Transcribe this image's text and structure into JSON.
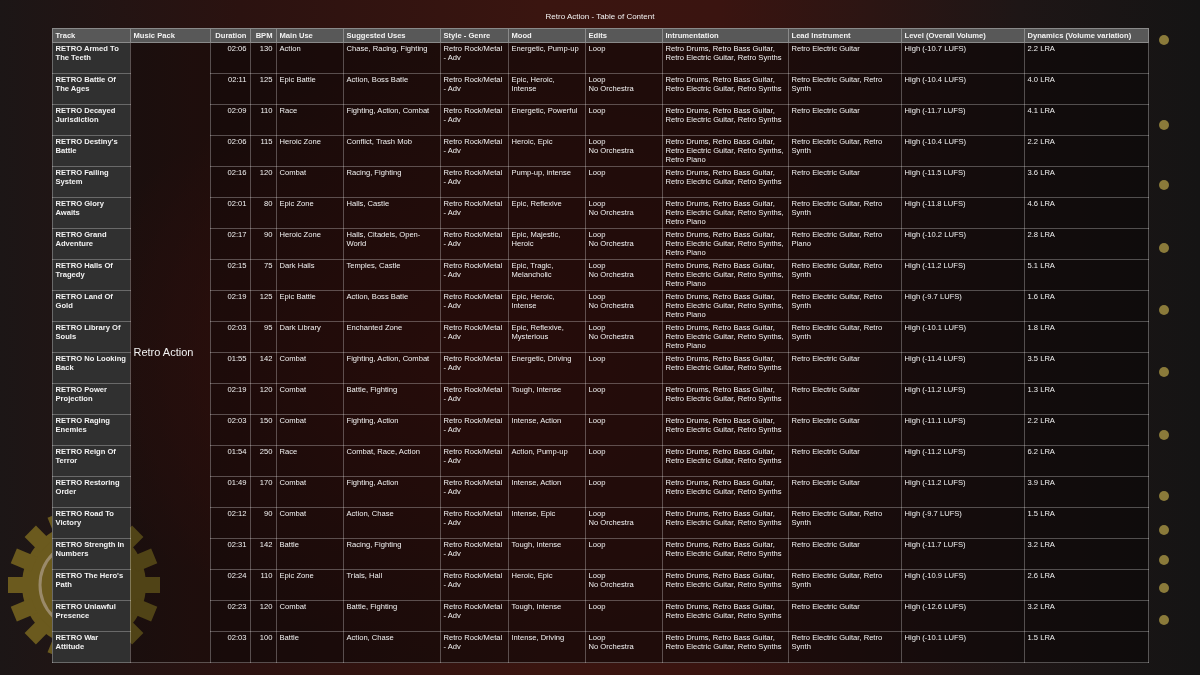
{
  "title": "Retro Action - Table of Content",
  "columns": [
    "Track",
    "Music Pack",
    "Duration",
    "BPM",
    "Main Use",
    "Suggested Uses",
    "Style - Genre",
    "Mood",
    "Edits",
    "Intrumentation",
    "Lead Instrument",
    "Level (Overall Volume)",
    "Dynamics (Volume variation)"
  ],
  "music_pack": "Retro Action",
  "rows": [
    {
      "track": "RETRO Armed To The Teeth",
      "duration": "02:06",
      "bpm": "130",
      "main_use": "Action",
      "suggested_uses": "Chase, Racing, Fighting",
      "style_genre": "Retro Rock/Metal - Adv",
      "mood": "Energetic, Pump-up",
      "edits": [
        "Loop"
      ],
      "instrumentation": "Retro Drums, Retro Bass Guitar, Retro Electric Guitar, Retro Synths",
      "lead_instrument": "Retro Electric Guitar",
      "level": "High (-10.7 LUFS)",
      "dynamics": "2.2 LRA"
    },
    {
      "track": "RETRO Battle Of The Ages",
      "duration": "02:11",
      "bpm": "125",
      "main_use": "Epic Battle",
      "suggested_uses": "Action, Boss Batle",
      "style_genre": "Retro Rock/Metal - Adv",
      "mood": "Epic, Heroic, Intense",
      "edits": [
        "Loop",
        "No Orchestra"
      ],
      "instrumentation": "Retro Drums, Retro Bass Guitar, Retro Electric Guitar, Retro Synths",
      "lead_instrument": "Retro Electric Guitar, Retro Synth",
      "level": "High (-10.4 LUFS)",
      "dynamics": "4.0 LRA"
    },
    {
      "track": "RETRO Decayed Jurisdiction",
      "duration": "02:09",
      "bpm": "110",
      "main_use": "Race",
      "suggested_uses": "Fighting, Action, Combat",
      "style_genre": "Retro Rock/Metal - Adv",
      "mood": "Energetic, Powerful",
      "edits": [
        "Loop"
      ],
      "instrumentation": "Retro Drums, Retro Bass Guitar, Retro Electric Guitar, Retro Synths",
      "lead_instrument": "Retro Electric Guitar",
      "level": "High (-11.7 LUFS)",
      "dynamics": "4.1 LRA"
    },
    {
      "track": "RETRO Destiny's Battle",
      "duration": "02:06",
      "bpm": "115",
      "main_use": "Heroic Zone",
      "suggested_uses": "Conflict, Trash Mob",
      "style_genre": "Retro Rock/Metal - Adv",
      "mood": "Heroic, Epic",
      "edits": [
        "Loop",
        "No Orchestra"
      ],
      "instrumentation": "Retro Drums, Retro Bass Guitar, Retro Electric Guitar, Retro Synths, Retro Piano",
      "lead_instrument": "Retro Electric Guitar, Retro Synth",
      "level": "High (-10.4 LUFS)",
      "dynamics": "2.2 LRA"
    },
    {
      "track": "RETRO Failing System",
      "duration": "02:16",
      "bpm": "120",
      "main_use": "Combat",
      "suggested_uses": "Racing, Fighting",
      "style_genre": "Retro Rock/Metal - Adv",
      "mood": "Pump-up, intense",
      "edits": [
        "Loop"
      ],
      "instrumentation": "Retro Drums, Retro Bass Guitar, Retro Electric Guitar, Retro Synths",
      "lead_instrument": "Retro Electric Guitar",
      "level": "High (-11.5 LUFS)",
      "dynamics": "3.6 LRA"
    },
    {
      "track": "RETRO Glory Awaits",
      "duration": "02:01",
      "bpm": "80",
      "main_use": "Epic Zone",
      "suggested_uses": "Halls, Castle",
      "style_genre": "Retro Rock/Metal - Adv",
      "mood": "Epic, Reflexive",
      "edits": [
        "Loop",
        "No Orchestra"
      ],
      "instrumentation": "Retro Drums, Retro Bass Guitar, Retro Electric Guitar, Retro Synths, Retro Piano",
      "lead_instrument": "Retro Electric Guitar, Retro Synth",
      "level": "High (-11.8 LUFS)",
      "dynamics": "4.6 LRA"
    },
    {
      "track": "RETRO Grand Adventure",
      "duration": "02:17",
      "bpm": "90",
      "main_use": "Heroic Zone",
      "suggested_uses": "Halls, Citadels, Open-World",
      "style_genre": "Retro Rock/Metal - Adv",
      "mood": "Epic, Majestic, Heroic",
      "edits": [
        "Loop",
        "No Orchestra"
      ],
      "instrumentation": "Retro Drums, Retro Bass Guitar, Retro Electric Guitar, Retro Synths, Retro Piano",
      "lead_instrument": "Retro Electric Guitar, Retro Piano",
      "level": "High (-10.2 LUFS)",
      "dynamics": "2.8 LRA"
    },
    {
      "track": "RETRO Halls Of Tragedy",
      "duration": "02:15",
      "bpm": "75",
      "main_use": "Dark Halls",
      "suggested_uses": "Temples, Castle",
      "style_genre": "Retro Rock/Metal - Adv",
      "mood": "Epic, Tragic, Melancholic",
      "edits": [
        "Loop",
        "No Orchestra"
      ],
      "instrumentation": "Retro Drums, Retro Bass Guitar, Retro Electric Guitar, Retro Synths, Retro Piano",
      "lead_instrument": "Retro Electric Guitar, Retro Synth",
      "level": "High (-11.2 LUFS)",
      "dynamics": "5.1 LRA"
    },
    {
      "track": "RETRO Land Of Gold",
      "duration": "02:19",
      "bpm": "125",
      "main_use": "Epic Battle",
      "suggested_uses": "Action, Boss Batle",
      "style_genre": "Retro Rock/Metal - Adv",
      "mood": "Epic, Heroic, Intense",
      "edits": [
        "Loop",
        "No Orchestra"
      ],
      "instrumentation": "Retro Drums, Retro Bass Guitar, Retro Electric Guitar, Retro Synths, Retro Piano",
      "lead_instrument": "Retro Electric Guitar, Retro Synth",
      "level": "High (-9.7 LUFS)",
      "dynamics": "1.6 LRA"
    },
    {
      "track": "RETRO Library Of Souls",
      "duration": "02:03",
      "bpm": "95",
      "main_use": "Dark Library",
      "suggested_uses": "Enchanted Zone",
      "style_genre": "Retro Rock/Metal - Adv",
      "mood": "Epic, Reflexive, Mysterious",
      "edits": [
        "Loop",
        "No Orchestra"
      ],
      "instrumentation": "Retro Drums, Retro Bass Guitar, Retro Electric Guitar, Retro Synths, Retro Piano",
      "lead_instrument": "Retro Electric Guitar, Retro Synth",
      "level": "High (-10.1 LUFS)",
      "dynamics": "1.8 LRA"
    },
    {
      "track": "RETRO No Looking Back",
      "duration": "01:55",
      "bpm": "142",
      "main_use": "Combat",
      "suggested_uses": "Fighting, Action, Combat",
      "style_genre": "Retro Rock/Metal - Adv",
      "mood": "Energetic, Driving",
      "edits": [
        "Loop"
      ],
      "instrumentation": "Retro Drums, Retro Bass Guitar, Retro Electric Guitar, Retro Synths",
      "lead_instrument": "Retro Electric Guitar",
      "level": "High (-11.4 LUFS)",
      "dynamics": "3.5 LRA"
    },
    {
      "track": "RETRO Power Projection",
      "duration": "02:19",
      "bpm": "120",
      "main_use": "Combat",
      "suggested_uses": "Battle, Fighting",
      "style_genre": "Retro Rock/Metal - Adv",
      "mood": "Tough, Intense",
      "edits": [
        "Loop"
      ],
      "instrumentation": "Retro Drums, Retro Bass Guitar, Retro Electric Guitar, Retro Synths",
      "lead_instrument": "Retro Electric Guitar",
      "level": "High (-11.2 LUFS)",
      "dynamics": "1.3 LRA"
    },
    {
      "track": "RETRO Raging Enemies",
      "duration": "02:03",
      "bpm": "150",
      "main_use": "Combat",
      "suggested_uses": "Fighting, Action",
      "style_genre": "Retro Rock/Metal - Adv",
      "mood": "Intense, Action",
      "edits": [
        "Loop"
      ],
      "instrumentation": "Retro Drums, Retro Bass Guitar, Retro Electric Guitar, Retro Synths",
      "lead_instrument": "Retro Electric Guitar",
      "level": "High (-11.1 LUFS)",
      "dynamics": "2.2 LRA"
    },
    {
      "track": "RETRO Reign Of Terror",
      "duration": "01:54",
      "bpm": "250",
      "main_use": "Race",
      "suggested_uses": "Combat, Race, Action",
      "style_genre": "Retro Rock/Metal - Adv",
      "mood": "Action, Pump-up",
      "edits": [
        "Loop"
      ],
      "instrumentation": "Retro Drums, Retro Bass Guitar, Retro Electric Guitar, Retro Synths",
      "lead_instrument": "Retro Electric Guitar",
      "level": "High (-11.2 LUFS)",
      "dynamics": "6.2 LRA"
    },
    {
      "track": "RETRO Restoring Order",
      "duration": "01:49",
      "bpm": "170",
      "main_use": "Combat",
      "suggested_uses": "Fighting, Action",
      "style_genre": "Retro Rock/Metal - Adv",
      "mood": "Intense, Action",
      "edits": [
        "Loop"
      ],
      "instrumentation": "Retro Drums, Retro Bass Guitar, Retro Electric Guitar, Retro Synths",
      "lead_instrument": "Retro Electric Guitar",
      "level": "High (-11.2 LUFS)",
      "dynamics": "3.9 LRA"
    },
    {
      "track": "RETRO Road To Victory",
      "duration": "02:12",
      "bpm": "90",
      "main_use": "Combat",
      "suggested_uses": "Action, Chase",
      "style_genre": "Retro Rock/Metal - Adv",
      "mood": "Intense, Epic",
      "edits": [
        "Loop",
        "No Orchestra"
      ],
      "instrumentation": "Retro Drums, Retro Bass Guitar, Retro Electric Guitar, Retro Synths",
      "lead_instrument": "Retro Electric Guitar, Retro Synth",
      "level": "High (-9.7 LUFS)",
      "dynamics": "1.5 LRA"
    },
    {
      "track": "RETRO Strength In Numbers",
      "duration": "02:31",
      "bpm": "142",
      "main_use": "Battle",
      "suggested_uses": "Racing, Fighting",
      "style_genre": "Retro Rock/Metal - Adv",
      "mood": "Tough, Intense",
      "edits": [
        "Loop"
      ],
      "instrumentation": "Retro Drums, Retro Bass Guitar, Retro Electric Guitar, Retro Synths",
      "lead_instrument": "Retro Electric Guitar",
      "level": "High (-11.7 LUFS)",
      "dynamics": "3.2 LRA"
    },
    {
      "track": "RETRO The Hero's Path",
      "duration": "02:24",
      "bpm": "110",
      "main_use": "Epic Zone",
      "suggested_uses": "Trials, Hall",
      "style_genre": "Retro Rock/Metal - Adv",
      "mood": "Heroic, Epic",
      "edits": [
        "Loop",
        "No Orchestra"
      ],
      "instrumentation": "Retro Drums, Retro Bass Guitar, Retro Electric Guitar, Retro Synths",
      "lead_instrument": "Retro Electric Guitar, Retro Synth",
      "level": "High (-10.9 LUFS)",
      "dynamics": "2.6 LRA"
    },
    {
      "track": "RETRO Unlawful Presence",
      "duration": "02:23",
      "bpm": "120",
      "main_use": "Combat",
      "suggested_uses": "Battle, Fighting",
      "style_genre": "Retro Rock/Metal - Adv",
      "mood": "Tough, Intense",
      "edits": [
        "Loop"
      ],
      "instrumentation": "Retro Drums, Retro Bass Guitar, Retro Electric Guitar, Retro Synths",
      "lead_instrument": "Retro Electric Guitar",
      "level": "High (-12.6 LUFS)",
      "dynamics": "3.2 LRA"
    },
    {
      "track": "RETRO War Attitude",
      "duration": "02:03",
      "bpm": "100",
      "main_use": "Battle",
      "suggested_uses": "Action, Chase",
      "style_genre": "Retro Rock/Metal - Adv",
      "mood": "Intense, Driving",
      "edits": [
        "Loop",
        "No Orchestra"
      ],
      "instrumentation": "Retro Drums, Retro Bass Guitar, Retro Electric Guitar, Retro Synths",
      "lead_instrument": "Retro Electric Guitar, Retro Synth",
      "level": "High (-10.1 LUFS)",
      "dynamics": "1.5 LRA"
    }
  ]
}
